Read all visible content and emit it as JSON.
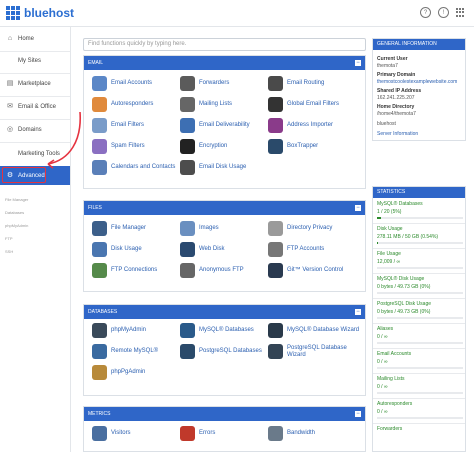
{
  "brand": {
    "name": "bluehost"
  },
  "topbar": {
    "icons": [
      "help-icon",
      "info-icon",
      "apps-grid-icon"
    ]
  },
  "sidebar": {
    "items": [
      {
        "label": "Home",
        "icon": "home-icon"
      },
      {
        "label": "My Sites",
        "icon": ""
      },
      {
        "label": "Marketplace",
        "icon": "shop-icon"
      },
      {
        "label": "Email & Office",
        "icon": "mail-icon"
      },
      {
        "label": "Domains",
        "icon": "globe-icon"
      },
      {
        "label": "Marketing Tools",
        "icon": ""
      },
      {
        "label": "Advanced",
        "icon": "gear-icon"
      }
    ],
    "sub_items": [
      "File Manager",
      "Databases",
      "phpMyAdmin",
      "FTP",
      "SSH"
    ]
  },
  "search": {
    "placeholder": "Find functions quickly by typing here."
  },
  "panels": {
    "email": {
      "title": "EMAIL",
      "apps": [
        {
          "label": "Email Accounts",
          "icon": "email-accounts-icon",
          "color": "#5b87c7"
        },
        {
          "label": "Forwarders",
          "icon": "forwarders-icon",
          "color": "#5b5b5b"
        },
        {
          "label": "Email Routing",
          "icon": "email-routing-icon",
          "color": "#4a4a4a"
        },
        {
          "label": "Autoresponders",
          "icon": "autoresponders-icon",
          "color": "#e08a3c"
        },
        {
          "label": "Mailing Lists",
          "icon": "mailing-lists-icon",
          "color": "#666666"
        },
        {
          "label": "Global Email Filters",
          "icon": "global-filter-icon",
          "color": "#333333"
        },
        {
          "label": "Email Filters",
          "icon": "email-filters-icon",
          "color": "#7a9cc9"
        },
        {
          "label": "Email Deliverability",
          "icon": "deliverability-icon",
          "color": "#3d6fb3"
        },
        {
          "label": "Address Importer",
          "icon": "address-importer-icon",
          "color": "#8a3b8a"
        },
        {
          "label": "Spam Filters",
          "icon": "spam-filters-icon",
          "color": "#8a6fc1"
        },
        {
          "label": "Encryption",
          "icon": "encryption-icon",
          "color": "#222222"
        },
        {
          "label": "BoxTrapper",
          "icon": "boxtrapper-icon",
          "color": "#2a4a6a"
        },
        {
          "label": "Calendars and Contacts",
          "icon": "calendar-icon",
          "color": "#5a7fb8"
        },
        {
          "label": "Email Disk Usage",
          "icon": "email-disk-icon",
          "color": "#4d4d4d"
        }
      ]
    },
    "files": {
      "title": "FILES",
      "apps": [
        {
          "label": "File Manager",
          "icon": "file-manager-icon",
          "color": "#3c5f8a"
        },
        {
          "label": "Images",
          "icon": "images-icon",
          "color": "#6a8fc0"
        },
        {
          "label": "Directory Privacy",
          "icon": "directory-privacy-icon",
          "color": "#9a9a9a"
        },
        {
          "label": "Disk Usage",
          "icon": "disk-usage-icon",
          "color": "#4a76b0"
        },
        {
          "label": "Web Disk",
          "icon": "web-disk-icon",
          "color": "#2a4a70"
        },
        {
          "label": "FTP Accounts",
          "icon": "ftp-accounts-icon",
          "color": "#777777"
        },
        {
          "label": "FTP Connections",
          "icon": "ftp-connections-icon",
          "color": "#558a4a"
        },
        {
          "label": "Anonymous FTP",
          "icon": "anonymous-ftp-icon",
          "color": "#666666"
        },
        {
          "label": "Git™ Version Control",
          "icon": "git-icon",
          "color": "#2a3a50"
        }
      ]
    },
    "databases": {
      "title": "DATABASES",
      "apps": [
        {
          "label": "phpMyAdmin",
          "icon": "phpmyadmin-icon",
          "color": "#3a4a5a"
        },
        {
          "label": "MySQL® Databases",
          "icon": "mysql-icon",
          "color": "#2a5a8a"
        },
        {
          "label": "MySQL® Database Wizard",
          "icon": "mysql-wizard-icon",
          "color": "#2a3a4a"
        },
        {
          "label": "Remote MySQL®",
          "icon": "remote-mysql-icon",
          "color": "#3a6aa0"
        },
        {
          "label": "PostgreSQL Databases",
          "icon": "postgresql-icon",
          "color": "#2a4a6a"
        },
        {
          "label": "PostgreSQL Database Wizard",
          "icon": "postgresql-wizard-icon",
          "color": "#334455"
        },
        {
          "label": "phpPgAdmin",
          "icon": "phppgadmin-icon",
          "color": "#b88a3a"
        }
      ]
    },
    "metrics": {
      "title": "METRICS",
      "apps": [
        {
          "label": "Visitors",
          "icon": "visitors-icon",
          "color": "#4a6fa0"
        },
        {
          "label": "Errors",
          "icon": "errors-icon",
          "color": "#c0392b"
        },
        {
          "label": "Bandwidth",
          "icon": "bandwidth-icon",
          "color": "#6a7a8a"
        }
      ]
    }
  },
  "general_info": {
    "title": "GENERAL INFORMATION",
    "current_user_label": "Current User",
    "current_user": "themota7",
    "primary_domain_label": "Primary Domain",
    "primary_domain": "themostcoolestexamplewebsite.com",
    "shared_ip_label": "Shared IP Address",
    "shared_ip": "162.241.225.207",
    "home_dir_label": "Home Directory",
    "home_dir": "/home4/themota7",
    "last_login_label": "",
    "home_dir_user": "bluehost",
    "server_info_link": "Server Information"
  },
  "statistics": {
    "title": "STATISTICS",
    "items": [
      {
        "label": "MySQL® Databases",
        "value": "1 / 20   (5%)",
        "fraction": 0.05
      },
      {
        "label": "Disk Usage",
        "value": "278.11 MB / 50 GB   (0.54%)",
        "fraction": 0.0054
      },
      {
        "label": "File Usage",
        "value": "12,009 / ∞",
        "fraction": 0
      },
      {
        "label": "MySQL® Disk Usage",
        "value": "0 bytes / 49.73 GB   (0%)",
        "fraction": 0
      },
      {
        "label": "PostgreSQL Disk Usage",
        "value": "0 bytes / 49.73 GB   (0%)",
        "fraction": 0
      },
      {
        "label": "Aliases",
        "value": "0 / ∞",
        "fraction": 0
      },
      {
        "label": "Email Accounts",
        "value": "0 / ∞",
        "fraction": 0
      },
      {
        "label": "Mailing Lists",
        "value": "0 / ∞",
        "fraction": 0
      },
      {
        "label": "Autoresponders",
        "value": "0 / ∞",
        "fraction": 0
      },
      {
        "label": "Forwarders",
        "value": "",
        "fraction": 0
      }
    ]
  }
}
